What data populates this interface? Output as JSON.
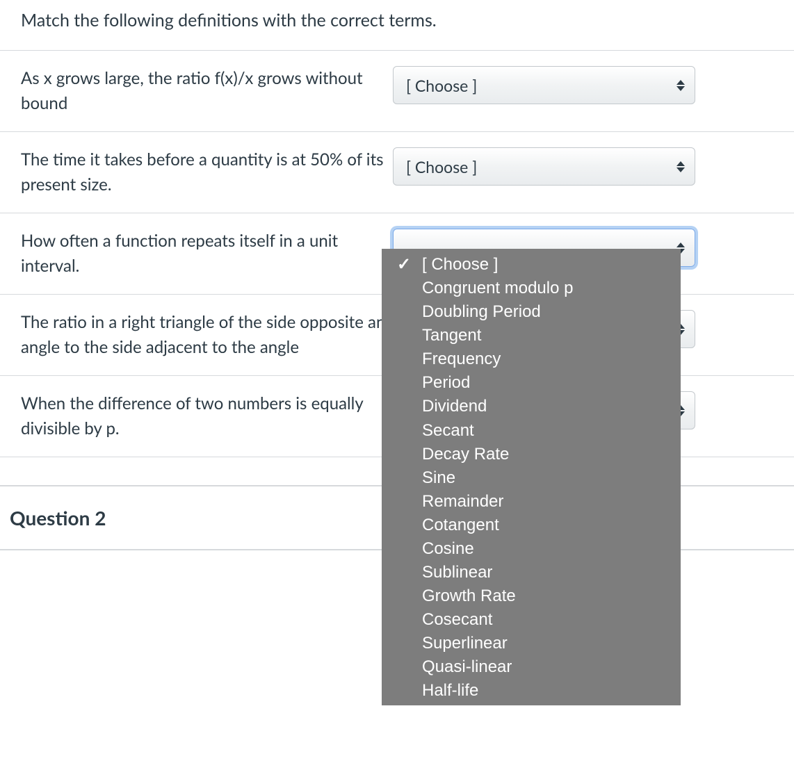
{
  "prompt": "Match the following definitions with the correct terms.",
  "placeholder": "[ Choose ]",
  "rows": [
    {
      "definition": "As x grows large, the ratio f(x)/x grows without bound"
    },
    {
      "definition": "The time it takes before a quantity is at 50% of its present size."
    },
    {
      "definition": "How often a function repeats itself in a unit interval."
    },
    {
      "definition": "The ratio in a right triangle of the side opposite an angle to the side adjacent to the angle"
    },
    {
      "definition": "When the difference of two numbers is equally divisible by p."
    }
  ],
  "dropdown": {
    "options": [
      "[ Choose ]",
      "Congruent modulo p",
      "Doubling Period",
      "Tangent",
      "Frequency",
      "Period",
      "Dividend",
      "Secant",
      "Decay Rate",
      "Sine",
      "Remainder",
      "Cotangent",
      "Cosine",
      "Sublinear",
      "Growth Rate",
      "Cosecant",
      "Superlinear",
      "Quasi-linear",
      "Half-life"
    ],
    "selected_index": 0
  },
  "next_question_title": "Question 2"
}
